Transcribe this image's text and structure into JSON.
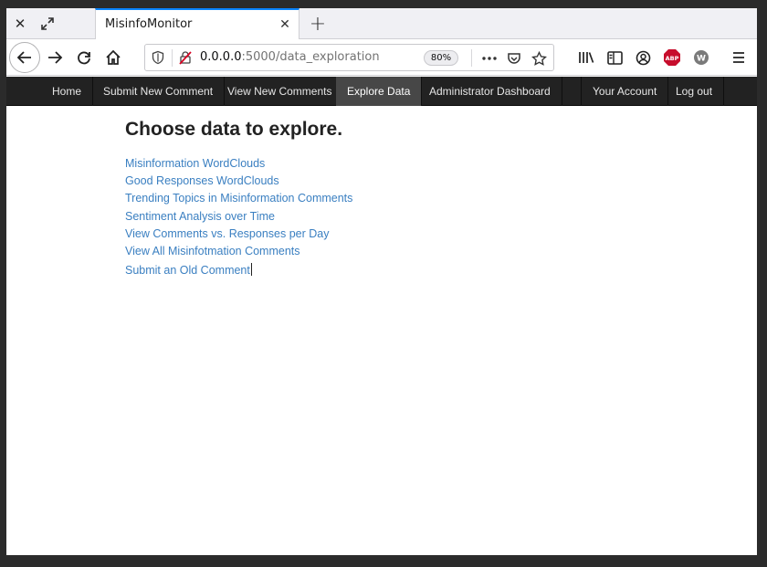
{
  "window": {
    "tab_title": "MisinfoMonitor",
    "url_host": "0.0.0.0",
    "url_rest": ":5000/data_exploration",
    "zoom": "80%",
    "adblock_label": "ABP",
    "ext_w_label": "W"
  },
  "sitenav": {
    "items": [
      {
        "label": "Home"
      },
      {
        "label": "Submit New Comment"
      },
      {
        "label": "View New Comments"
      },
      {
        "label": "Explore Data",
        "active": true
      },
      {
        "label": "Administrator Dashboard"
      },
      {
        "label": "Your Account"
      },
      {
        "label": "Log out"
      }
    ]
  },
  "main": {
    "title": "Choose data to explore.",
    "links": [
      {
        "label": "Misinformation WordClouds"
      },
      {
        "label": "Good Responses WordClouds"
      },
      {
        "label": "Trending Topics in Misinformation Comments"
      },
      {
        "label": "Sentiment Analysis over Time"
      },
      {
        "label": "View Comments vs. Responses per Day"
      },
      {
        "label": "View All Misinfotmation Comments"
      },
      {
        "label": "Submit an Old Comment"
      }
    ]
  },
  "colors": {
    "link": "#3a7fc1",
    "navbar_bg": "#222222",
    "active_tab": "#474747",
    "tab_highlight": "#0a84ff"
  }
}
